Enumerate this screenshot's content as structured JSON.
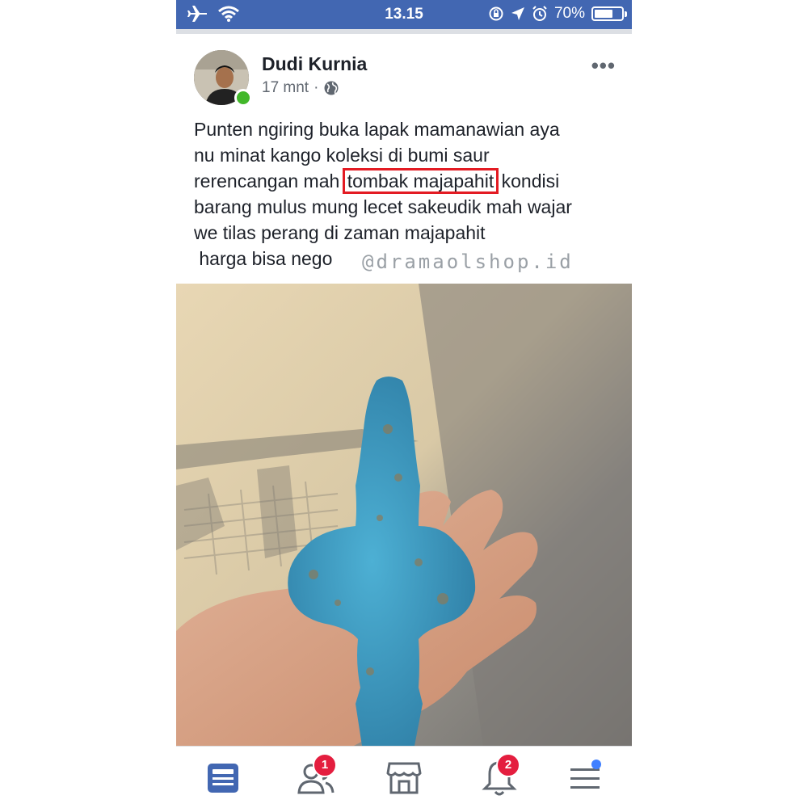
{
  "status_bar": {
    "time": "13.15",
    "battery_percent": "70%",
    "battery_level": 0.7
  },
  "post": {
    "author": "Dudi Kurnia",
    "time": "17 mnt",
    "separator": "·",
    "more_label": "•••",
    "text": {
      "line1": "Punten ngiring buka lapak mamanawian aya",
      "line2": "nu minat kango koleksi di bumi saur",
      "line3_before": "rerencangan mah ",
      "line3_highlight": "tombak majapahit",
      "line3_after": " kondisi",
      "line4": "barang mulus mung lecet sakeudik mah wajar",
      "line5": "we tilas perang di zaman majapahit",
      "line6": " harga bisa nego"
    },
    "watermark": "@dramaolshop.id"
  },
  "tabs": [
    {
      "name": "news-feed",
      "badge": ""
    },
    {
      "name": "friends",
      "badge": "1"
    },
    {
      "name": "marketplace",
      "badge": ""
    },
    {
      "name": "notifications",
      "badge": "2"
    },
    {
      "name": "menu",
      "badge": ""
    }
  ],
  "colors": {
    "brand": "#4267b2",
    "highlight_box": "#e31b23",
    "badge": "#e41e3f",
    "online": "#42b72a"
  }
}
